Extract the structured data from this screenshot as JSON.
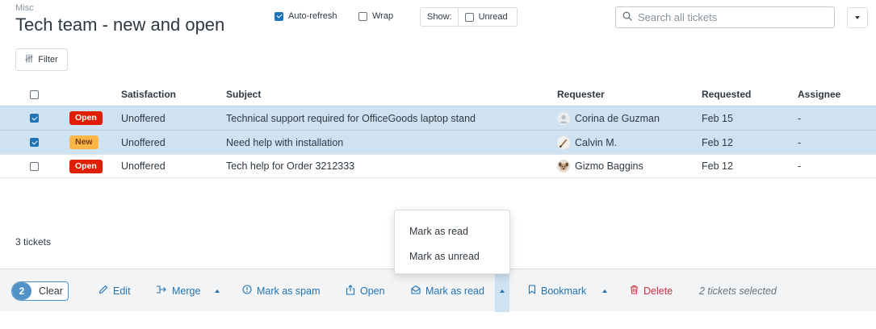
{
  "header": {
    "breadcrumb": "Misc",
    "title": "Tech team - new and open",
    "auto_refresh": {
      "label": "Auto-refresh",
      "checked": true
    },
    "wrap": {
      "label": "Wrap",
      "checked": false
    },
    "show": {
      "label": "Show:",
      "unread_label": "Unread",
      "unread_checked": false
    },
    "search": {
      "placeholder": "Search all tickets",
      "value": "",
      "icon": "search-icon"
    },
    "menu_icon": "chevron-down-icon",
    "filter": {
      "label": "Filter",
      "icon": "sliders-icon"
    }
  },
  "table": {
    "columns": [
      "",
      "",
      "Satisfaction",
      "Subject",
      "Requester",
      "Requested",
      "Assignee"
    ],
    "rows": [
      {
        "selected": true,
        "status": "Open",
        "status_color": "#e01e00",
        "satisfaction": "Unoffered",
        "subject": "Technical support required for OfficeGoods laptop stand",
        "requester": "Corina de Guzman",
        "requested": "Feb 15",
        "assignee": "-"
      },
      {
        "selected": true,
        "status": "New",
        "status_color": "#ffb648",
        "satisfaction": "Unoffered",
        "subject": "Need help with installation",
        "requester": "Calvin M.",
        "requested": "Feb 12",
        "assignee": "-"
      },
      {
        "selected": false,
        "status": "Open",
        "status_color": "#e01e00",
        "satisfaction": "Unoffered",
        "subject": "Tech help for Order 3212333",
        "requester": "Gizmo Baggins",
        "requested": "Feb 12",
        "assignee": "-"
      }
    ]
  },
  "ticket_count": "3 tickets",
  "dropdown": {
    "items": [
      "Mark as read",
      "Mark as unread"
    ]
  },
  "actionbar": {
    "selected_count": "2",
    "clear_label": "Clear",
    "edit_label": "Edit",
    "merge_label": "Merge",
    "spam_label": "Mark as spam",
    "open_label": "Open",
    "mark_read_label": "Mark as read",
    "bookmark_label": "Bookmark",
    "delete_label": "Delete",
    "selected_text": "2 tickets selected"
  },
  "colors": {
    "accent": "#1f73b7",
    "selected_row": "#cfe2f2",
    "danger": "#cc3340"
  }
}
